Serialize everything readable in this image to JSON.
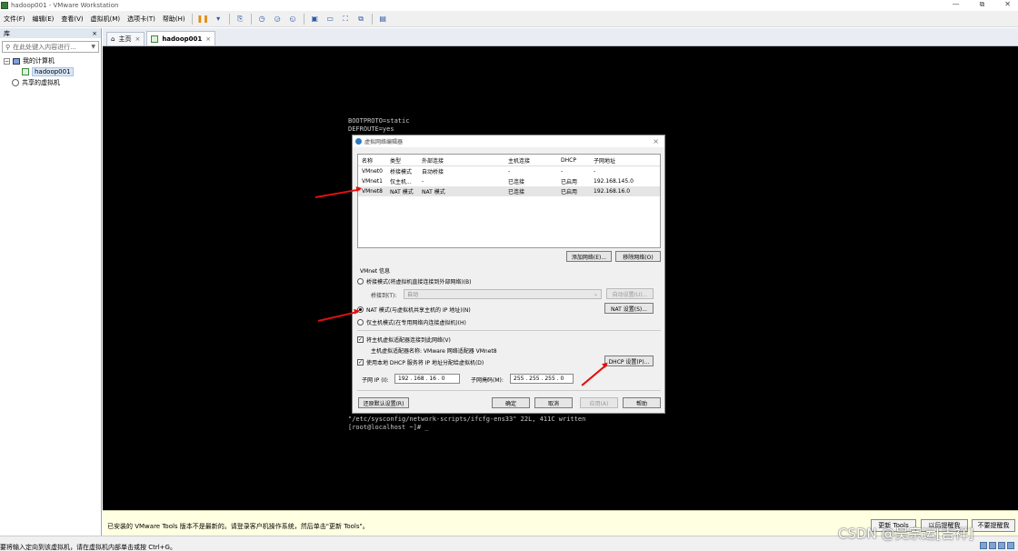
{
  "window": {
    "title": "hadoop001 - VMware Workstation",
    "minimize": "—",
    "maximize": "⧉",
    "close": "✕"
  },
  "menu": [
    "文件(F)",
    "编辑(E)",
    "查看(V)",
    "虚拟机(M)",
    "选项卡(T)",
    "帮助(H)"
  ],
  "library": {
    "header": "库",
    "close": "×",
    "search_placeholder": "在此处键入内容进行...",
    "tree": {
      "my_computer": "我的计算机",
      "vm": "hadoop001",
      "shared": "共享的虚拟机"
    }
  },
  "tabs": [
    {
      "label": "主页",
      "close": "×"
    },
    {
      "label": "hadoop001",
      "close": "×"
    }
  ],
  "terminal": {
    "top_lines": [
      "BOOTPROTO=static",
      "DEFROUTE=yes"
    ],
    "bottom_lines": [
      "\"/etc/sysconfig/network-scripts/ifcfg-ens33\" 22L, 411C written",
      "[root@localhost ~]# _"
    ]
  },
  "dialog": {
    "title": "虚拟网络编辑器",
    "close": "×",
    "columns": [
      "名称",
      "类型",
      "外部连接",
      "主机连接",
      "DHCP",
      "子网地址"
    ],
    "rows": [
      [
        "VMnet0",
        "桥接模式",
        "自动桥接",
        "-",
        "-",
        "-"
      ],
      [
        "VMnet1",
        "仅主机...",
        "-",
        "已连接",
        "已启用",
        "192.168.145.0"
      ],
      [
        "VMnet8",
        "NAT 模式",
        "NAT 模式",
        "已连接",
        "已启用",
        "192.168.16.0"
      ]
    ],
    "add_network": "添加网络(E)...",
    "remove_network": "移除网络(O)",
    "info_label": "VMnet 信息",
    "bridge_mode": "桥接模式(将虚拟机直接连接到外部网络)(B)",
    "bridge_to_label": "桥接到(T):",
    "bridge_to_value": "自动",
    "auto_settings": "自动设置(U)...",
    "nat_mode": "NAT 模式(与虚拟机共享主机的 IP 地址)(N)",
    "nat_settings": "NAT 设置(S)...",
    "host_only_mode": "仅主机模式(在专用网络内连接虚拟机)(H)",
    "connect_adapter": "将主机虚拟适配器连接到此网络(V)",
    "adapter_name": "主机虚拟适配器名称: VMware 网络适配器 VMnet8",
    "use_dhcp": "使用本地 DHCP 服务将 IP 地址分配给虚拟机(D)",
    "dhcp_settings": "DHCP 设置(P)...",
    "subnet_ip_label": "子网 IP (I):",
    "subnet_ip": "192 . 168 . 16 . 0",
    "subnet_mask_label": "子网掩码(M):",
    "subnet_mask": "255 . 255 . 255 . 0",
    "restore_defaults": "还原默认设置(R)",
    "ok": "确定",
    "cancel": "取消",
    "apply": "应用(A)",
    "help": "帮助"
  },
  "notification": {
    "message": "已安装的 VMware Tools 版本不是最新的。请登录客户机操作系统，然后单击\"更新 Tools\"。",
    "update_tools": "更新 Tools",
    "remind_later": "以后提醒我",
    "never_remind": "不要提醒我"
  },
  "status": {
    "text": "要将输入定向到该虚拟机，请在虚拟机内部单击或按 Ctrl+G。"
  },
  "watermark": "CSDN @吴宗运[吉祥]"
}
